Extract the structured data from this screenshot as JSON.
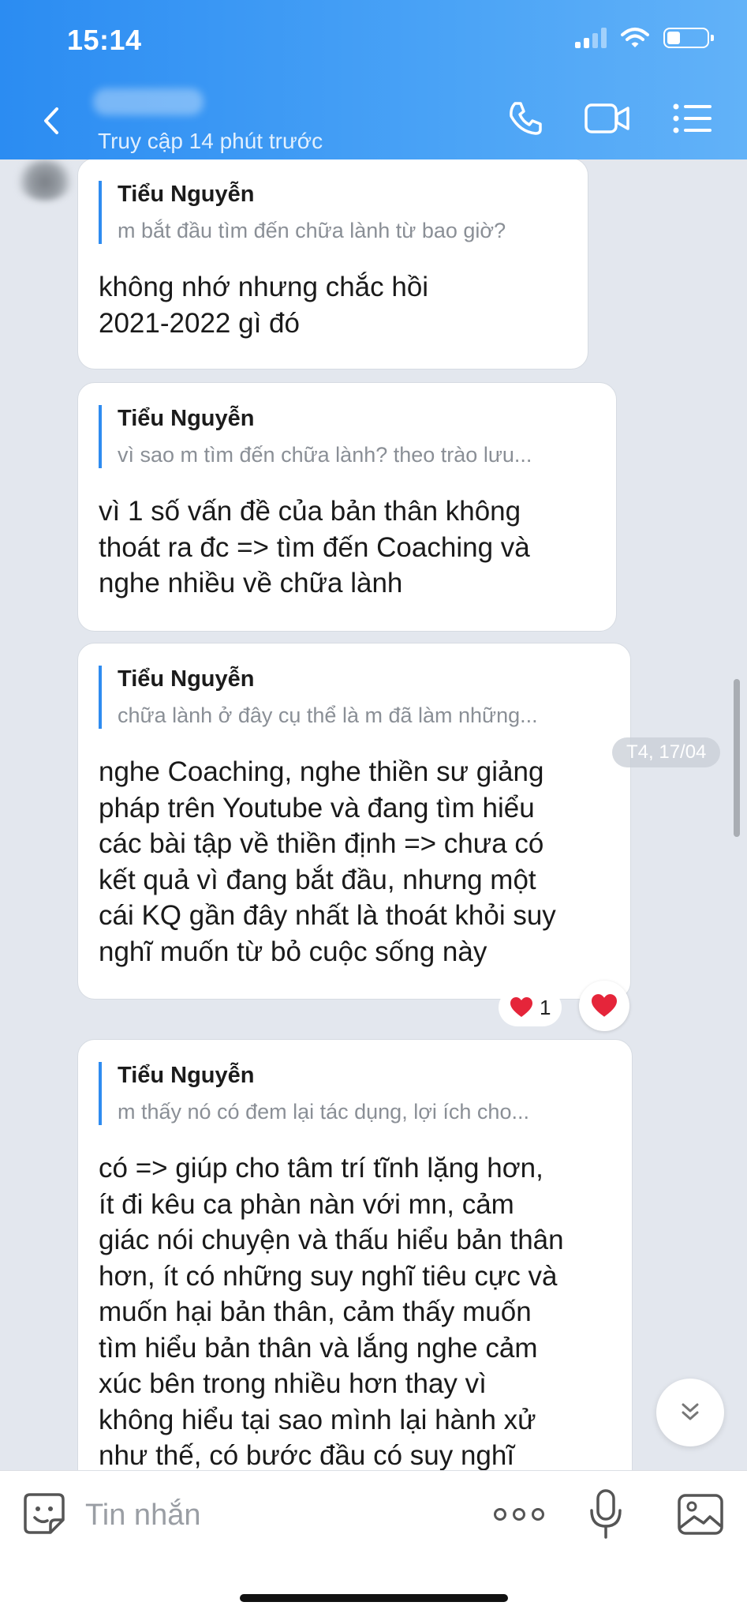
{
  "status_bar": {
    "time": "15:14",
    "battery_level": 0.35
  },
  "header": {
    "last_seen": "Truy cập 14 phút trước",
    "icons": [
      "back-icon",
      "phone-icon",
      "video-call-icon",
      "menu-list-icon"
    ]
  },
  "messages": [
    {
      "quote_name": "Tiểu Nguyễn",
      "quote_text": "m bắt đầu tìm đến chữa lành từ bao giờ?",
      "text": "không nhớ nhưng chắc hồi\n2021-2022 gì đó"
    },
    {
      "quote_name": "Tiểu Nguyễn",
      "quote_text": "vì sao m tìm đến chữa lành? theo trào lưu...",
      "text": "vì 1 số vấn đề của bản thân không\nthoát ra đc => tìm đến Coaching và\nnghe nhiều về chữa lành"
    },
    {
      "quote_name": "Tiểu Nguyễn",
      "quote_text": "chữa lành ở đây cụ thể là m đã làm những...",
      "text": "nghe Coaching, nghe thiền sư giảng\npháp trên Youtube và đang tìm hiểu\ncác bài tập về thiền định => chưa có\nkết quả vì đang bắt đầu, nhưng một\ncái KQ gần đây nhất là thoát khỏi suy\nnghĩ muốn từ bỏ cuộc sống này"
    },
    {
      "quote_name": "Tiểu Nguyễn",
      "quote_text": "m thấy nó có đem lại tác dụng, lợi ích cho...",
      "text": "có => giúp cho tâm trí tĩnh lặng hơn,\nít đi kêu ca phàn nàn với mn, cảm\ngiác nói chuyện và thấu hiểu bản thân\nhơn, ít có những suy nghĩ tiêu cực và\nmuốn hại bản thân, cảm thấy muốn\ntìm hiểu bản thân và lắng nghe cảm\nxúc bên trong nhiều hơn thay vì\nkhông hiểu tại sao mình lại hành xử\nnhư thế, có bước đầu có suy nghĩ"
    }
  ],
  "date_chip": "T4, 17/04",
  "reaction": {
    "emoji": "heart-icon",
    "count": "1",
    "color": "#e5253a"
  },
  "composer": {
    "placeholder": "Tin nhắn"
  },
  "colors": {
    "header_start": "#2b8cf2",
    "header_end": "#62b2f8",
    "quote_bar": "#2f8cf0",
    "chat_bg": "#e3e7ee"
  }
}
